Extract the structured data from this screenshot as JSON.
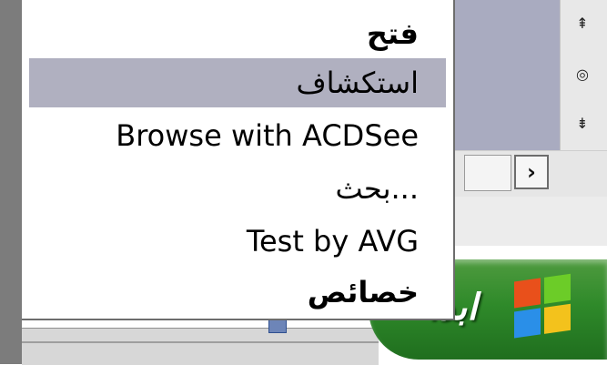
{
  "context_menu": {
    "items": [
      {
        "label": "فتح",
        "bold": true,
        "highlighted": false
      },
      {
        "label": "استكشاف",
        "bold": false,
        "highlighted": true
      },
      {
        "label": "Browse with ACDSee",
        "bold": false,
        "highlighted": false
      },
      {
        "label": "بحث...",
        "bold": false,
        "highlighted": false
      },
      {
        "label": "Test by AVG",
        "bold": false,
        "highlighted": false
      },
      {
        "label": "خصائص",
        "bold": false,
        "highlighted": false
      }
    ],
    "highlight_color": "#b0b0c0"
  },
  "scrollbar": {
    "up_icon": "up-arrow-icon",
    "middle_icon": "circle-icon",
    "down_icon": "down-arrow-icon",
    "up_glyph": "⇞",
    "middle_glyph": "◎",
    "down_glyph": "⇟"
  },
  "nav": {
    "forward_glyph": "›"
  },
  "start_button": {
    "label": "ابدأ",
    "color": "#2f8a2a"
  }
}
